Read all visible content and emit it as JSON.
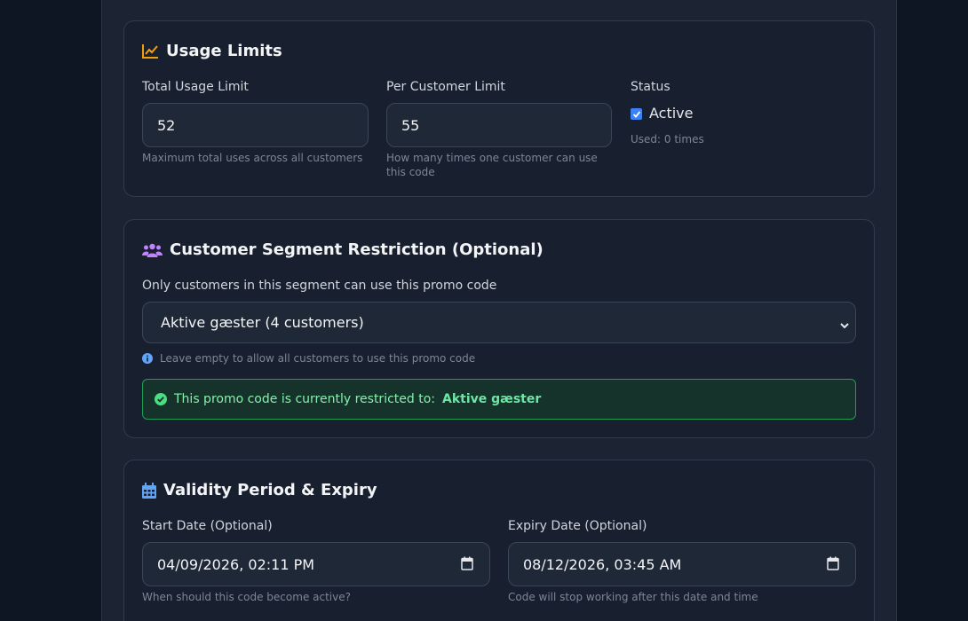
{
  "usage": {
    "title": "Usage Limits",
    "total_label": "Total Usage Limit",
    "total_value": "52",
    "total_help": "Maximum total uses across all customers",
    "per_customer_label": "Per Customer Limit",
    "per_customer_value": "55",
    "per_customer_help_1": "How many times one customer can use",
    "per_customer_help_2": "this code",
    "status_label": "Status",
    "active_label": "Active",
    "active_checked": true,
    "used_text": "Used: 0 times"
  },
  "segment": {
    "title": "Customer Segment Restriction (Optional)",
    "description": "Only customers in this segment can use this promo code",
    "selected": "Aktive gæster (4 customers)",
    "help": "Leave empty to allow all customers to use this promo code",
    "notice_prefix": "This promo code is currently restricted to:",
    "notice_segment": "Aktive gæster"
  },
  "validity": {
    "title": "Validity Period & Expiry",
    "start_label": "Start Date (Optional)",
    "start_value": "04/09/2026, 02:11 PM",
    "start_help": "When should this code become active?",
    "expiry_label": "Expiry Date (Optional)",
    "expiry_value": "08/12/2026, 03:45 AM",
    "expiry_help": "Code will stop working after this date and time"
  },
  "colors": {
    "usage_icon": "#f59e0b",
    "segment_icon": "#c084fc",
    "validity_icon": "#60a5fa",
    "success": "#22c55e"
  },
  "icons": [
    "chart-line-icon",
    "users-icon",
    "info-icon",
    "check-circle-icon",
    "calendar-icon"
  ]
}
